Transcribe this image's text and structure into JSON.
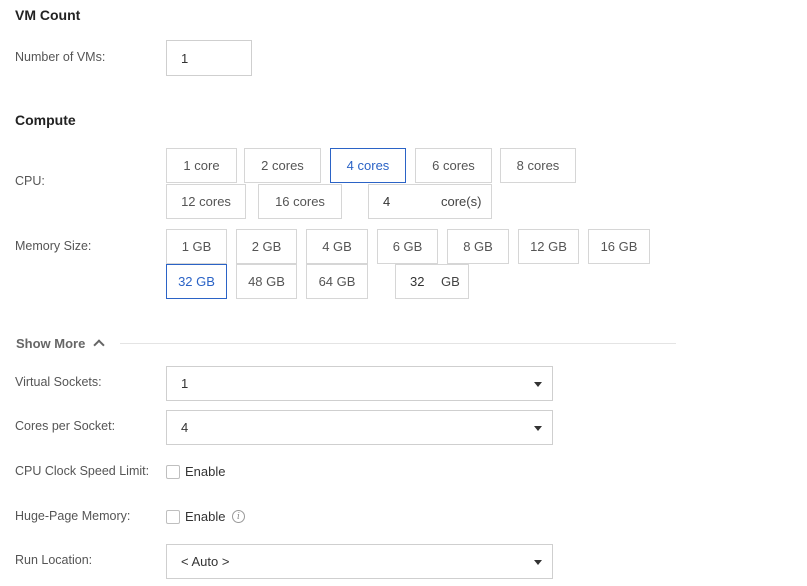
{
  "vm_count": {
    "title": "VM Count",
    "number_label": "Number of VMs:",
    "number_value": "1"
  },
  "compute": {
    "title": "Compute",
    "cpu_label": "CPU:",
    "cpu_options": [
      "1 core",
      "2 cores",
      "4 cores",
      "6 cores",
      "8 cores",
      "12 cores",
      "16 cores"
    ],
    "cpu_selected": "4 cores",
    "cpu_custom_value": "4",
    "cpu_custom_unit": "core(s)",
    "memory_label": "Memory Size:",
    "memory_options": [
      "1 GB",
      "2 GB",
      "4 GB",
      "6 GB",
      "8 GB",
      "12 GB",
      "16 GB",
      "32 GB",
      "48 GB",
      "64 GB"
    ],
    "memory_selected": "32 GB",
    "memory_custom_value": "32",
    "memory_custom_unit": "GB"
  },
  "show_more": {
    "label": "Show More",
    "expanded": true
  },
  "advanced": {
    "virtual_sockets_label": "Virtual Sockets:",
    "virtual_sockets_value": "1",
    "cores_per_socket_label": "Cores per Socket:",
    "cores_per_socket_value": "4",
    "cpu_clock_label": "CPU Clock Speed Limit:",
    "cpu_clock_enable_label": "Enable",
    "cpu_clock_enabled": false,
    "huge_page_label": "Huge-Page Memory:",
    "huge_page_enable_label": "Enable",
    "huge_page_enabled": false,
    "run_location_label": "Run Location:",
    "run_location_value": "< Auto >"
  },
  "colors": {
    "accent": "#2b63c6",
    "border": "#d6d6d6"
  },
  "icons": {
    "dropdown": "caret-down-icon",
    "show_more": "chevron-up-icon",
    "info": "info-icon"
  }
}
